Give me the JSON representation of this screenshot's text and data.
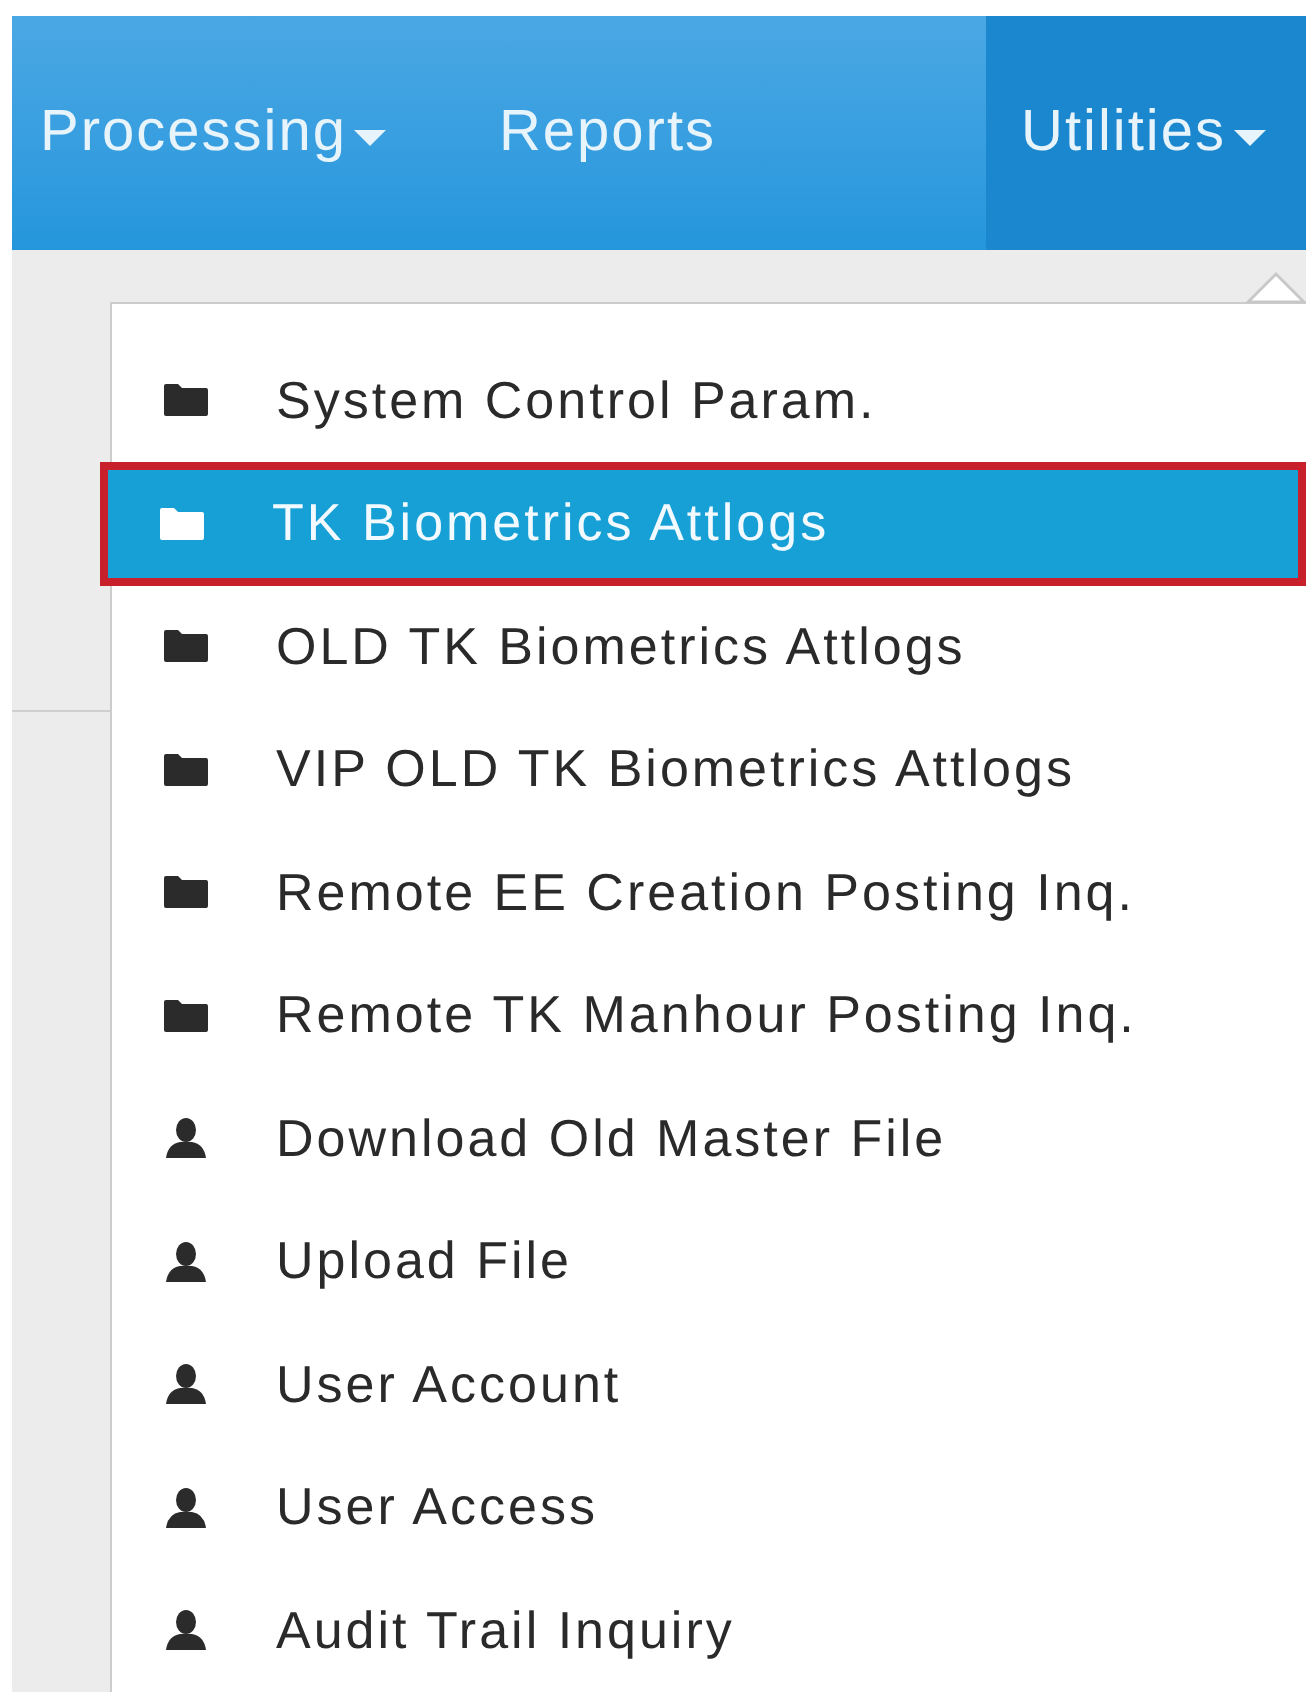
{
  "navbar": {
    "items": [
      {
        "label": "Processing",
        "dropdown": true,
        "selected": false
      },
      {
        "label": "Reports",
        "dropdown": false,
        "selected": false
      },
      {
        "label": "Utilities",
        "dropdown": true,
        "selected": true
      }
    ]
  },
  "menu": {
    "items": [
      {
        "kind": "folder",
        "label": "System Control Param.",
        "selected": false
      },
      {
        "kind": "folder",
        "label": "TK Biometrics Attlogs",
        "selected": true
      },
      {
        "kind": "folder",
        "label": "OLD TK Biometrics Attlogs",
        "selected": false
      },
      {
        "kind": "folder",
        "label": "VIP OLD TK Biometrics Attlogs",
        "selected": false
      },
      {
        "kind": "folder",
        "label": "Remote EE Creation Posting Inq.",
        "selected": false
      },
      {
        "kind": "folder",
        "label": "Remote TK Manhour Posting Inq.",
        "selected": false
      },
      {
        "kind": "user",
        "label": "Download Old Master File",
        "selected": false
      },
      {
        "kind": "user",
        "label": "Upload File",
        "selected": false
      },
      {
        "kind": "user",
        "label": "User Account",
        "selected": false
      },
      {
        "kind": "user",
        "label": "User Access",
        "selected": false
      },
      {
        "kind": "user",
        "label": "Audit Trail Inquiry",
        "selected": false
      }
    ]
  }
}
